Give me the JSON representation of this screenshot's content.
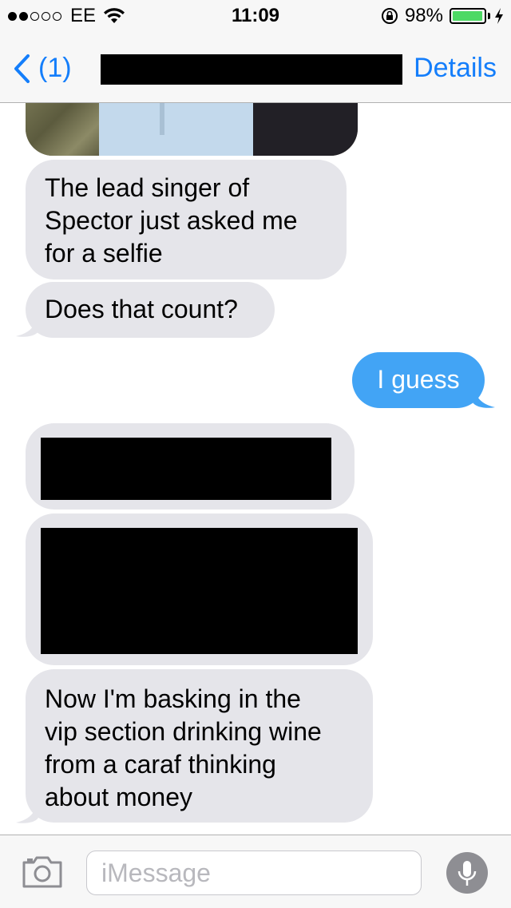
{
  "status_bar": {
    "carrier": "EE",
    "signal_bars_filled": 2,
    "signal_bars_total": 5,
    "time": "11:09",
    "battery_percent_text": "98%",
    "battery_level": 0.98,
    "battery_color": "#4cd964"
  },
  "nav": {
    "back_label": "(1)",
    "details_label": "Details",
    "accent_color": "#147efb"
  },
  "messages": {
    "received_1": "The lead singer of\nSpector just asked me\nfor a selfie",
    "received_2": "Does that count?",
    "sent_1": "I guess",
    "received_3": "Now I'm basking in the\nvip section drinking wine\nfrom a caraf thinking\nabout money"
  },
  "colors": {
    "received_bubble": "#e5e5ea",
    "sent_bubble": "#42a4f5"
  },
  "input_bar": {
    "placeholder": "iMessage",
    "value": "",
    "camera_icon": "camera-icon",
    "mic_icon": "microphone-icon"
  }
}
